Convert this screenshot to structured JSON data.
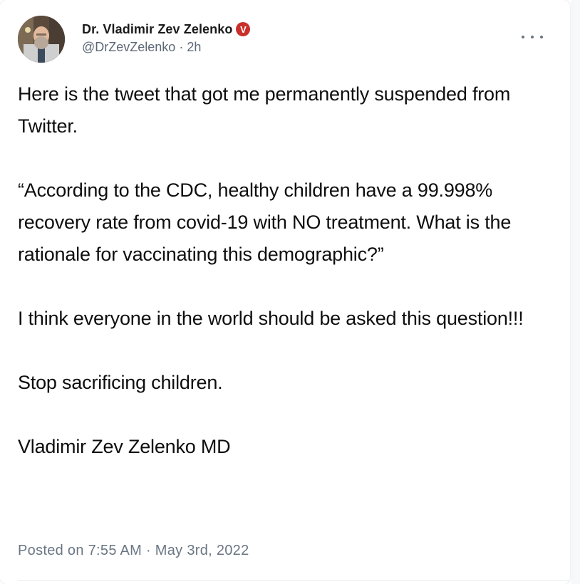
{
  "author": {
    "name": "Dr. Vladimir Zev Zelenko",
    "verified_badge": "V",
    "handle": "@DrZevZelenko",
    "separator": "·",
    "age": "2h"
  },
  "post": {
    "line1": "Here is the tweet that got me permanently suspended from Twitter.",
    "line2": "“According to the CDC, healthy children  have a 99.998% recovery rate from covid-19 with NO treatment. What is the rationale for vaccinating this demographic?”",
    "line3": "I think everyone in the world should be asked this question!!!",
    "line4": "Stop sacrificing children.",
    "line5": "Vladimir Zev Zelenko MD"
  },
  "footer": {
    "posted": "Posted on 7:55 AM · May 3rd, 2022"
  },
  "colors": {
    "badge": "#c9302c",
    "meta_text": "#5d6875",
    "body_text": "#0e0e0e"
  },
  "icons": {
    "more": "horizontal-ellipsis",
    "verified": "verified-badge"
  }
}
